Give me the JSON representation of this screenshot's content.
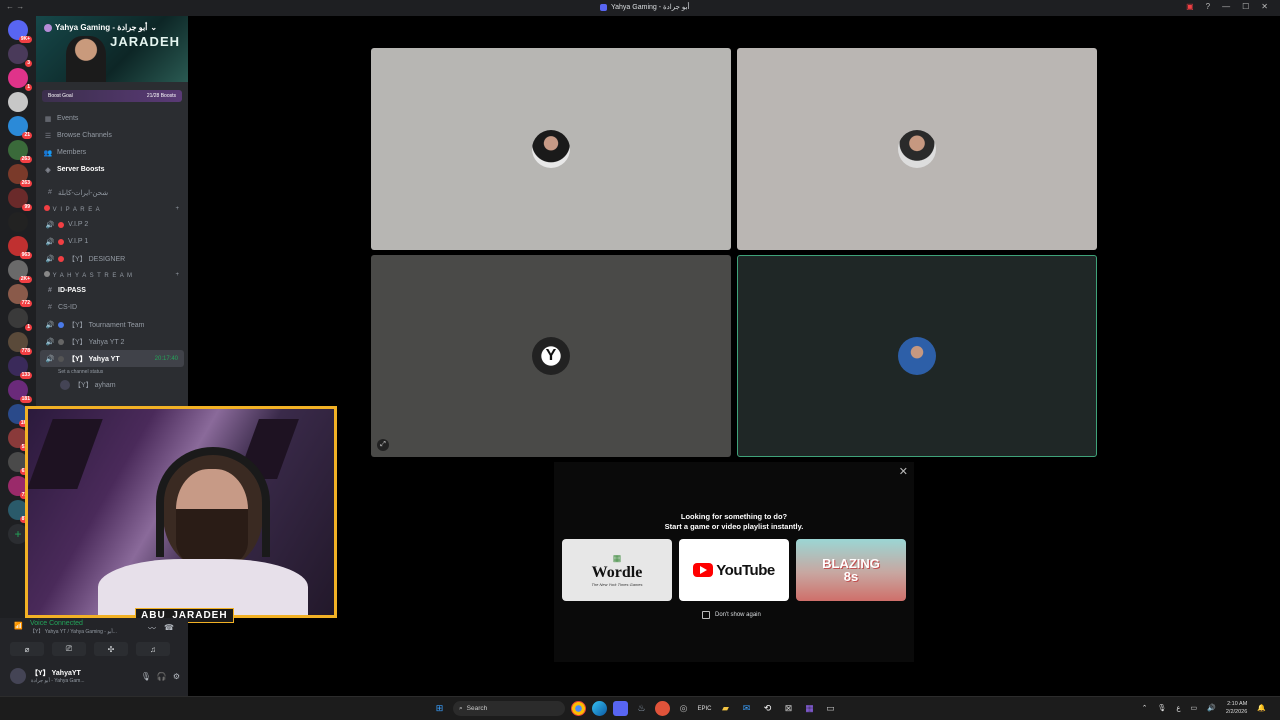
{
  "window": {
    "title": "Yahya Gaming - أبو جرادة"
  },
  "guilds": [
    {
      "color": "#5865f2",
      "badge": "9K+"
    },
    {
      "color": "#4a3a5a",
      "badge": "3"
    },
    {
      "color": "#e0338a",
      "badge": "1"
    },
    {
      "color": "#c7c7c7",
      "badge": ""
    },
    {
      "color": "#2b8ad8",
      "badge": "21"
    },
    {
      "color": "#3a6a3a",
      "badge": "263"
    },
    {
      "color": "#7a3a2a",
      "badge": "263"
    },
    {
      "color": "#6a2a2a",
      "badge": "99"
    },
    {
      "color": "#222",
      "badge": ""
    },
    {
      "color": "#c03030",
      "badge": "963"
    },
    {
      "color": "#6a6a6a",
      "badge": "2K+"
    },
    {
      "color": "#8a5a4a",
      "badge": "772"
    },
    {
      "color": "#3a3a3a",
      "badge": "1"
    },
    {
      "color": "#5a4a3a",
      "badge": "778"
    },
    {
      "color": "#3a2a5a",
      "badge": "133"
    },
    {
      "color": "#6a2a7a",
      "badge": "181"
    },
    {
      "color": "#2a4a8a",
      "badge": "1K+"
    },
    {
      "color": "#8a3a3a",
      "badge": "518"
    },
    {
      "color": "#4a4a4a",
      "badge": "610"
    },
    {
      "color": "#9a2a6a",
      "badge": "718"
    },
    {
      "color": "#2a5a6a",
      "badge": "878"
    }
  ],
  "server": {
    "name": "Yahya Gaming - أبو جرادة",
    "banner_logo": "JARADEH",
    "boost_goal_label": "Boost Goal",
    "boost_count": "21/28 Boosts"
  },
  "menu": [
    {
      "icon": "▦",
      "label": "Events",
      "bold": false
    },
    {
      "icon": "☰",
      "label": "Browse Channels",
      "bold": false
    },
    {
      "icon": "👥",
      "label": "Members",
      "bold": false
    },
    {
      "icon": "◈",
      "label": "Server Boosts",
      "bold": true
    }
  ],
  "channels_top": [
    {
      "label": "شحن-ايرات-كابلة"
    }
  ],
  "category_vip": "V I P   A R E A",
  "vip_channels": [
    {
      "label": "V.I.P 2"
    },
    {
      "label": "V.I.P 1"
    },
    {
      "label": "【Y】 DESIGNER"
    }
  ],
  "category_stream": "Y A H Y A   S T R E A M",
  "stream_channels": [
    {
      "label": "ID-PASS",
      "bold": true
    },
    {
      "label": "CS-ID",
      "bold": false
    },
    {
      "label": "【Y】 Tournament Team",
      "bold": false
    },
    {
      "label": "【Y】 Yahya YT 2",
      "bold": false
    }
  ],
  "active_channel": {
    "label": "【Y】 Yahya YT",
    "time": "20:17:40",
    "status_hint": "Set a channel status"
  },
  "voice_member": "【Y】 ayham",
  "webcam_label": "ABU_JARADEH",
  "voice": {
    "status": "Voice Connected",
    "location": "【Y】 Yahya YT / Yahya Gaming - أبو..."
  },
  "user": {
    "name": "【Y】 YahyaYT",
    "status": "أبو جرادة - Yahya Gam..."
  },
  "activity_popup": {
    "title_line1": "Looking for something to do?",
    "title_line2": "Start a game or video playlist instantly.",
    "wordle": "Wordle",
    "wordle_sub": "The New York Times Games",
    "youtube": "YouTube",
    "blazing": "BLAZING",
    "blazing_num": "8s",
    "checkbox": "Don't show again"
  },
  "taskbar": {
    "search": "Search",
    "time": "2:10 AM",
    "date": "2/2/2026",
    "lang": "ع"
  }
}
